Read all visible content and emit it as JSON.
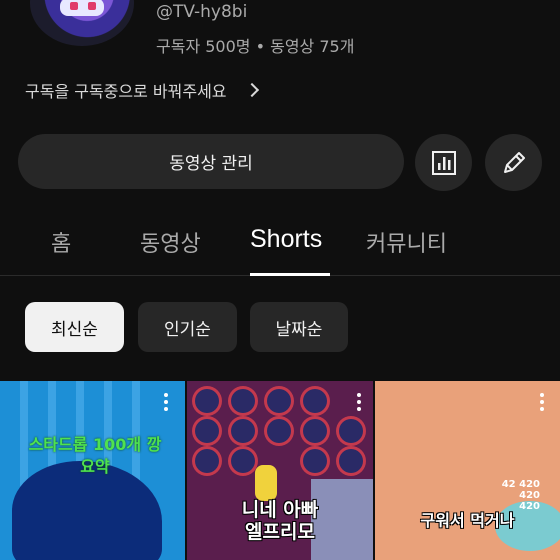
{
  "channel": {
    "handle": "@TV-hy8bi",
    "stats": "구독자 500명 • 동영상 75개",
    "subscription_hint": "구독을 구독중으로 바꿔주세요"
  },
  "actions": {
    "manage_label": "동영상 관리",
    "analytics_icon": "bar-chart-icon",
    "edit_icon": "pencil-icon"
  },
  "tabs": [
    {
      "label": "홈",
      "active": false
    },
    {
      "label": "동영상",
      "active": false
    },
    {
      "label": "Shorts",
      "active": true
    },
    {
      "label": "커뮤니티",
      "active": false
    }
  ],
  "filters": [
    {
      "label": "최신순",
      "selected": true
    },
    {
      "label": "인기순",
      "selected": false
    },
    {
      "label": "날짜순",
      "selected": false
    }
  ],
  "shorts": [
    {
      "caption_line1": "스타드롭 100개 깡",
      "caption_line2": "요약"
    },
    {
      "caption_line1": "니네 아빠",
      "caption_line2": "엘프리모"
    },
    {
      "caption_line1": "구워서 먹거나",
      "hud_line1": "42 420",
      "hud_line2": "420",
      "hud_line3": "420"
    }
  ],
  "colors": {
    "background": "#0f0f0f",
    "chip_bg": "#272727",
    "selected_chip_bg": "#f1f1f1",
    "secondary_text": "#aaaaaa"
  }
}
